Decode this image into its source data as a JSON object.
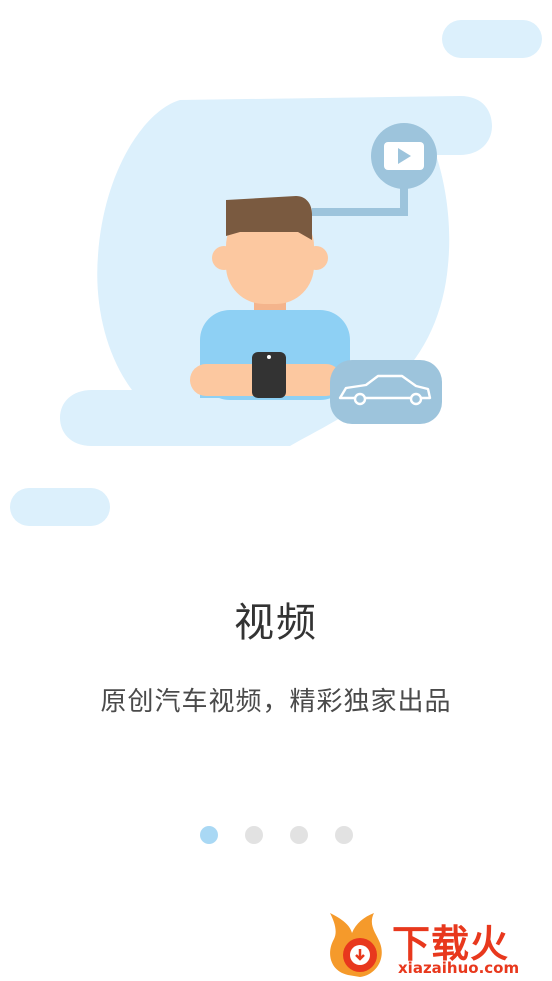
{
  "onboarding": {
    "title": "视频",
    "subtitle": "原创汽车视频，精彩独家出品"
  },
  "pager": {
    "total": 4,
    "active_index": 0
  },
  "watermark": {
    "brand": "下载火",
    "url": "xiazaihuo.com"
  },
  "colors": {
    "blob": "#dcf0fc",
    "shirt": "#8ed0f4",
    "hair": "#7a5a40",
    "skin": "#fcc8a0",
    "badge": "#9dc4dc",
    "dot_active": "#a9d8f4",
    "dot_inactive": "#e2e2e2",
    "brand_red": "#e8381d"
  }
}
